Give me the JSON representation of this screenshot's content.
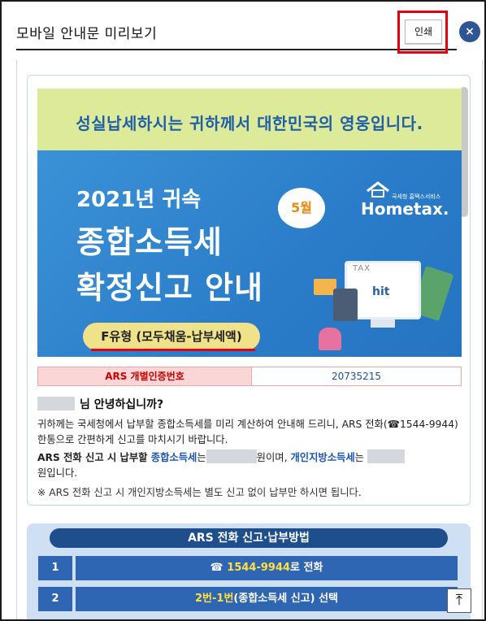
{
  "window": {
    "title": "모바일 안내문 미리보기",
    "print_label": "인쇄",
    "close_icon": "×"
  },
  "banner": {
    "slogan": "성실납세하시는 귀하께서 대한민국의 영웅입니다.",
    "year": "2021년 귀속",
    "headline1": "종합소득세",
    "headline2": "확정신고 안내",
    "type": "F유형 (모두채움-납부세액)",
    "month_badge": "5월",
    "brand": "Hometax.",
    "brand_sub": "국세청 홈택스서비스",
    "monitor_text": "TAX",
    "monitor_logo": "hit"
  },
  "ars": {
    "label": "ARS 개별인증번호",
    "value": "20735215"
  },
  "greeting": {
    "suffix": "님 안녕하십니까?"
  },
  "body": {
    "p1": "귀하께는 국세청에서 납부할 종합소득세를 미리 계산하여 안내해 드리니, ARS 전화(☎1544-9944) 한통으로 간편하게 신고를 마치시기 바랍니다.",
    "p2_a": "ARS 전화 신고 시 납부할 ",
    "p2_b": "종합소득세",
    "p2_c": "는",
    "p2_d": "원이며, ",
    "p2_e": "개인지방소득세",
    "p2_f": "는",
    "p2_g": "원입니다.",
    "p3": "※ ARS 전화 신고 시 개인지방소득세는 별도 신고 없이 납부만 하시면 됩니다."
  },
  "method": {
    "title": "ARS 전화 신고·납부방법",
    "steps": [
      {
        "num": "1",
        "icon": "☎",
        "highlight": "1544-9944",
        "rest": "로 전화"
      },
      {
        "num": "2",
        "highlight": "2번-1번",
        "rest": "(종합소득세 신고) 선택"
      }
    ]
  },
  "scroll_top_icon": "⤒",
  "colors": {
    "accent": "#2f5597",
    "print_outline": "#e5000f",
    "banner_blue": "#2a7cc8",
    "banner_top": "#dcea9a"
  }
}
